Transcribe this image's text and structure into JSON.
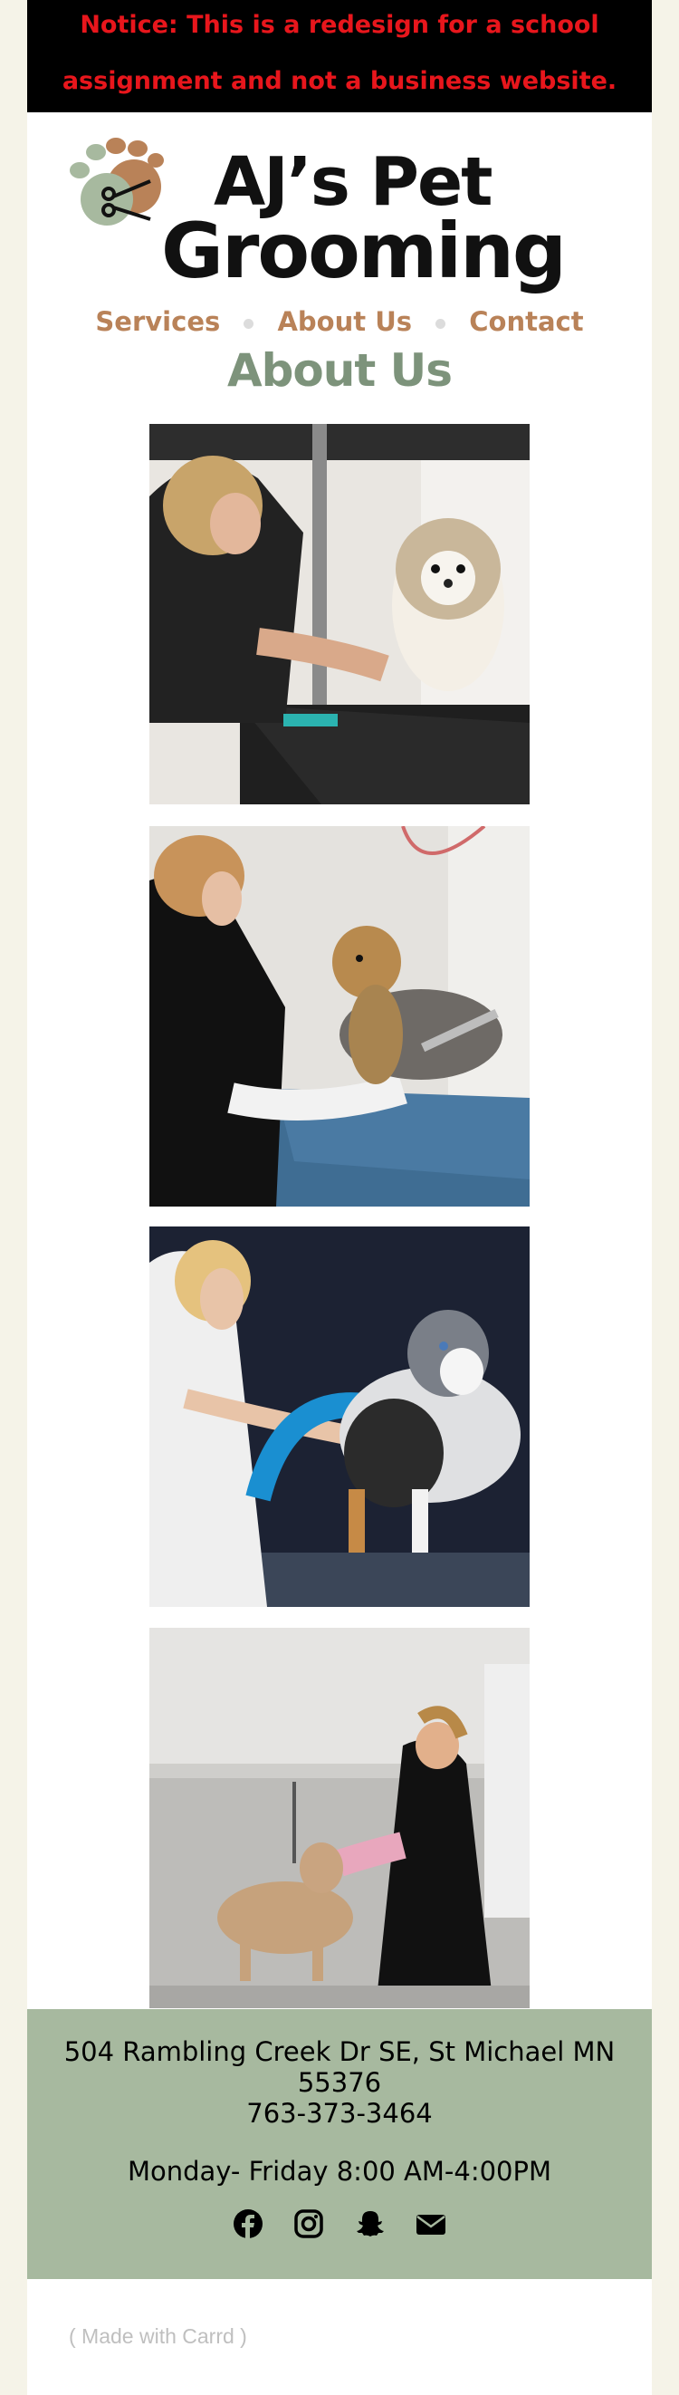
{
  "notice": {
    "line1": "Notice: This is a redesign for a school",
    "line2": "assignment and not a business website."
  },
  "logo": {
    "line1": "AJ’s Pet",
    "line2": "Grooming"
  },
  "nav": {
    "items": [
      "Services",
      "About Us",
      "Contact"
    ]
  },
  "page": {
    "title": "About Us"
  },
  "footer": {
    "address_line1": "504 Rambling Creek Dr SE, St Michael MN",
    "address_line2": "55376",
    "phone": "763-373-3464",
    "hours": "Monday- Friday 8:00 AM-4:00PM",
    "social_icons": [
      "facebook-icon",
      "instagram-icon",
      "snapchat-icon",
      "envelope-icon"
    ]
  },
  "made_with": "( Made with Carrd )",
  "colors": {
    "notice_bg": "#000000",
    "notice_text": "#e8161c",
    "accent_brown": "#b98258",
    "accent_green": "#7d937b",
    "footer_bg": "#a7b99f",
    "page_bg": "#f5f3e8"
  }
}
